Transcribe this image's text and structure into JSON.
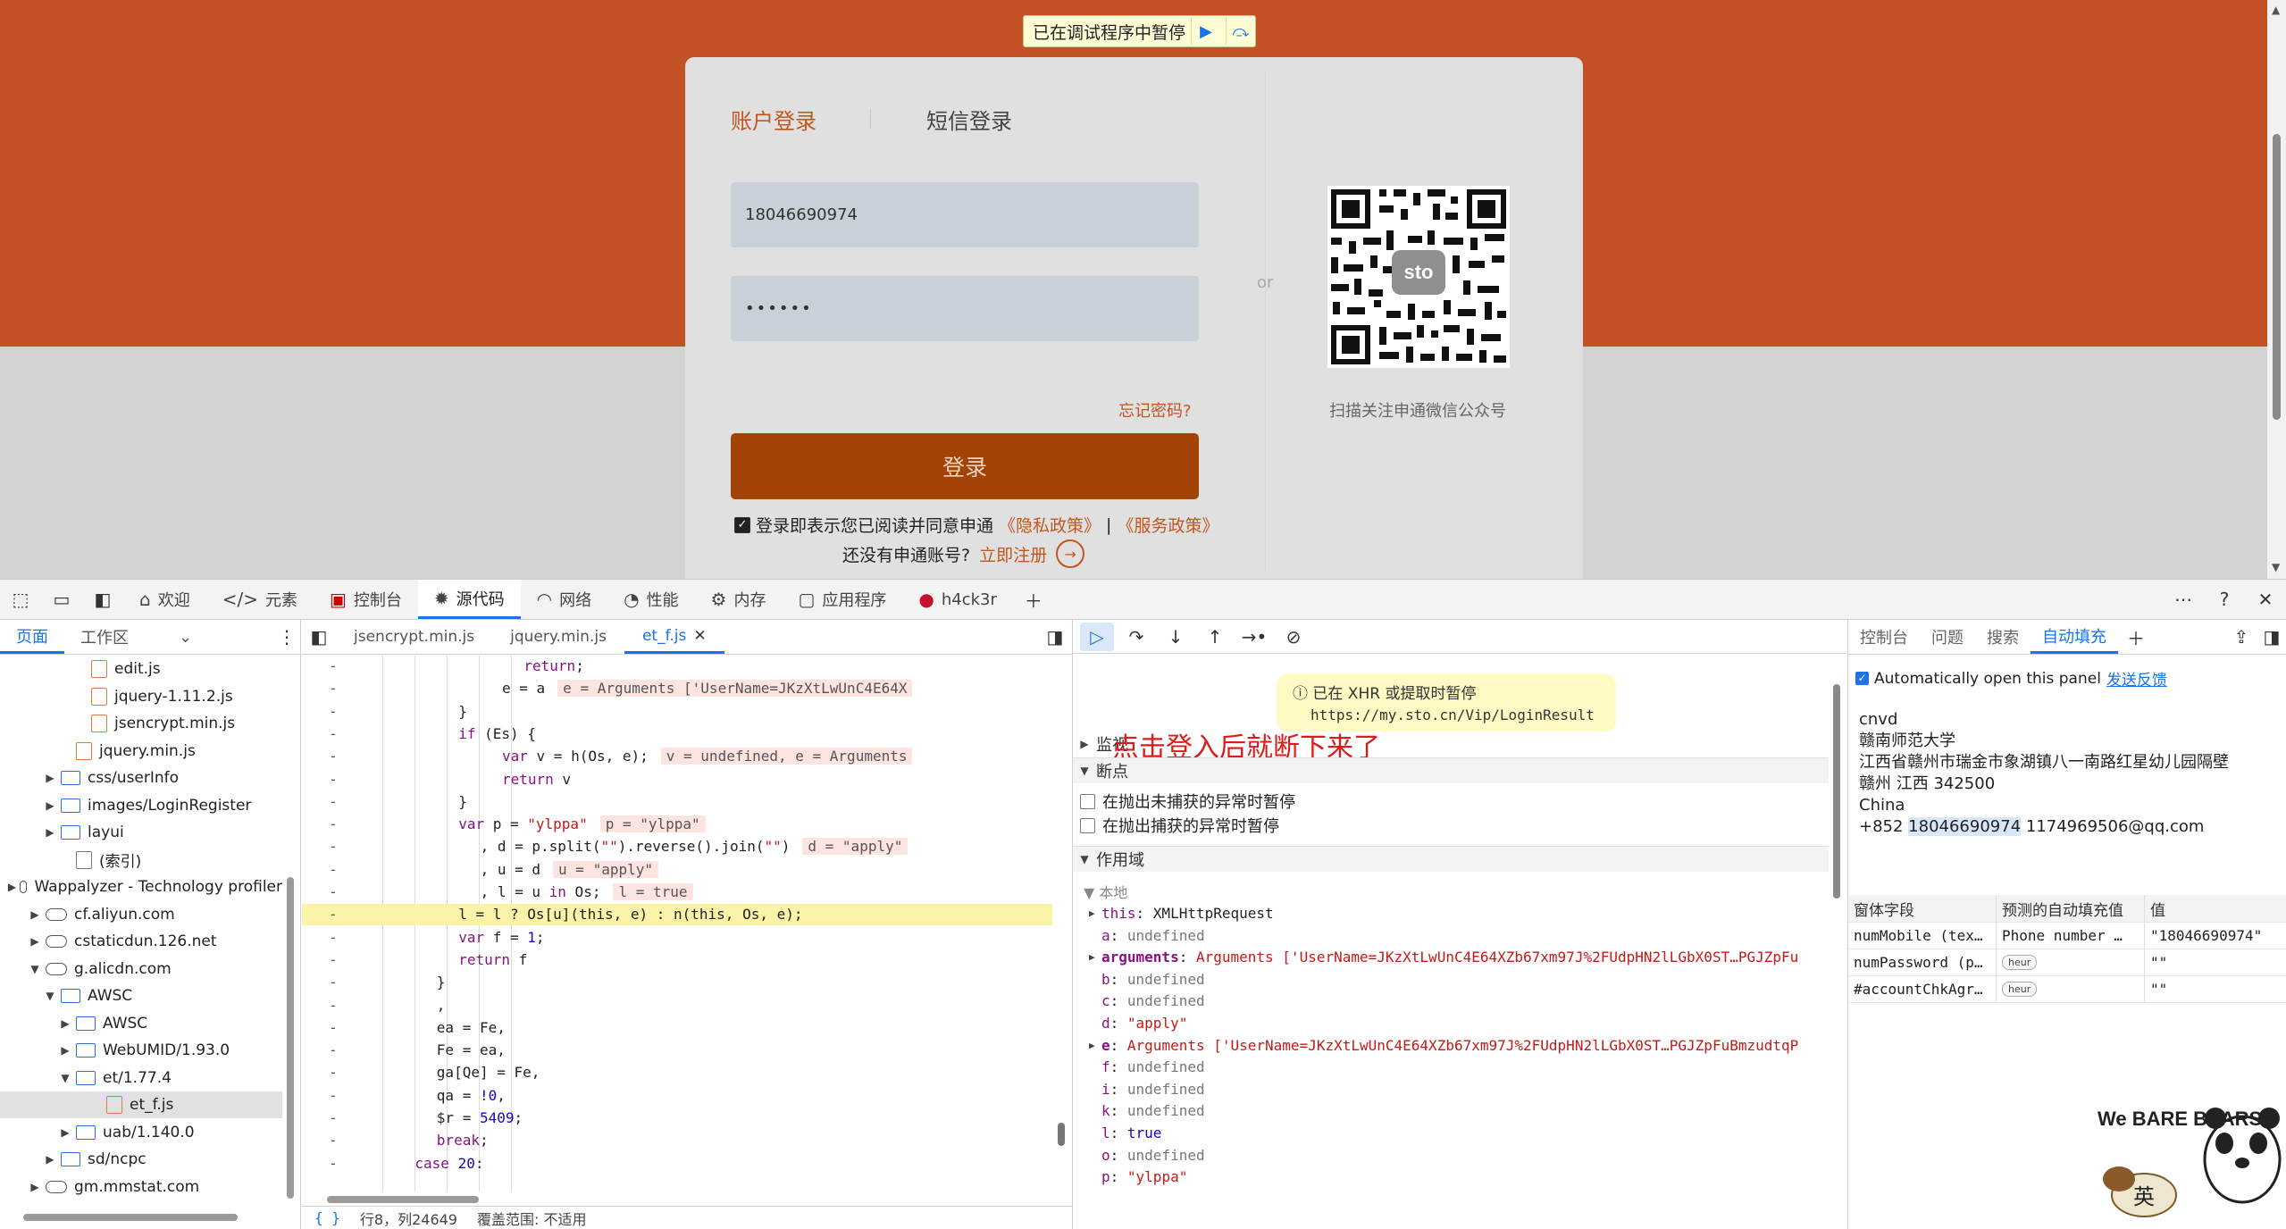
{
  "page": {
    "paused_banner": "已在调试程序中暂停",
    "login": {
      "tabs": [
        "账户登录",
        "短信登录"
      ],
      "phone_value": "18046690974",
      "password_value": "••••••",
      "forgot": "忘记密码?",
      "login_button": "登录",
      "agree_prefix": "登录即表示您已阅读并同意申通",
      "privacy_link": "《隐私政策》",
      "agree_sep": "|",
      "service_link": "《服务政策》",
      "no_account": "还没有申通账号?",
      "register_link": "立即注册",
      "or": "or",
      "qr_caption": "扫描关注申通微信公众号",
      "qr_logo": "sto"
    }
  },
  "devtools": {
    "main_tabs": [
      {
        "label": "欢迎",
        "icon": "home-icon"
      },
      {
        "label": "元素",
        "icon": "code-icon"
      },
      {
        "label": "控制台",
        "icon": "console-icon"
      },
      {
        "label": "源代码",
        "icon": "bug-icon"
      },
      {
        "label": "网络",
        "icon": "wifi-icon"
      },
      {
        "label": "性能",
        "icon": "gauge-icon"
      },
      {
        "label": "内存",
        "icon": "memory-icon"
      },
      {
        "label": "应用程序",
        "icon": "app-icon"
      },
      {
        "label": "h4ck3r",
        "icon": "extension-icon"
      }
    ],
    "navigator": {
      "tabs": [
        "页面",
        "工作区"
      ],
      "tree": [
        {
          "label": "edit.js",
          "type": "file",
          "indent": 4
        },
        {
          "label": "jquery-1.11.2.js",
          "type": "file",
          "indent": 4
        },
        {
          "label": "jsencrypt.min.js",
          "type": "file",
          "indent": 4
        },
        {
          "label": "jquery.min.js",
          "type": "file",
          "indent": 3
        },
        {
          "label": "css/userInfo",
          "type": "folder",
          "indent": 2,
          "arrow": "right"
        },
        {
          "label": "images/LoginRegister",
          "type": "folder",
          "indent": 2,
          "arrow": "right"
        },
        {
          "label": "layui",
          "type": "folder",
          "indent": 2,
          "arrow": "right"
        },
        {
          "label": "(索引)",
          "type": "page",
          "indent": 3
        },
        {
          "label": "Wappalyzer - Technology profiler",
          "type": "cloud",
          "indent": 1,
          "arrow": "right"
        },
        {
          "label": "cf.aliyun.com",
          "type": "cloud",
          "indent": 1,
          "arrow": "right"
        },
        {
          "label": "cstaticdun.126.net",
          "type": "cloud",
          "indent": 1,
          "arrow": "right"
        },
        {
          "label": "g.alicdn.com",
          "type": "cloud",
          "indent": 1,
          "arrow": "down"
        },
        {
          "label": "AWSC",
          "type": "folder",
          "indent": 2,
          "arrow": "down"
        },
        {
          "label": "AWSC",
          "type": "folder",
          "indent": 3,
          "arrow": "right"
        },
        {
          "label": "WebUMID/1.93.0",
          "type": "folder",
          "indent": 3,
          "arrow": "right"
        },
        {
          "label": "et/1.77.4",
          "type": "folder",
          "indent": 3,
          "arrow": "down"
        },
        {
          "label": "et_f.js",
          "type": "file",
          "indent": 5,
          "selected": true
        },
        {
          "label": "uab/1.140.0",
          "type": "folder",
          "indent": 3,
          "arrow": "right"
        },
        {
          "label": "sd/ncpc",
          "type": "folder",
          "indent": 2,
          "arrow": "right"
        },
        {
          "label": "gm.mmstat.com",
          "type": "cloud",
          "indent": 1,
          "arrow": "right"
        }
      ]
    },
    "editor": {
      "tabs": [
        "jsencrypt.min.js",
        "jquery.min.js",
        "et_f.js"
      ],
      "active_tab": "et_f.js",
      "gutter": "-",
      "lines": [
        {
          "indent": 11,
          "parts": [
            [
              "kw",
              "return"
            ],
            [
              "pl",
              ";"
            ]
          ]
        },
        {
          "indent": 10,
          "parts": [
            [
              "pl",
              "e = a"
            ]
          ],
          "ann": "e = Arguments ['UserName=JKzXtLwUnC4E64X"
        },
        {
          "indent": 8,
          "parts": [
            [
              "pl",
              "}"
            ]
          ]
        },
        {
          "indent": 8,
          "parts": [
            [
              "kw",
              "if"
            ],
            [
              "pl",
              " (Es) {"
            ]
          ]
        },
        {
          "indent": 10,
          "parts": [
            [
              "kw",
              "var"
            ],
            [
              "pl",
              " v = h(Os, e);"
            ]
          ],
          "ann": "v = undefined, e = Arguments"
        },
        {
          "indent": 10,
          "parts": [
            [
              "kw",
              "return"
            ],
            [
              "pl",
              " v"
            ]
          ]
        },
        {
          "indent": 8,
          "parts": [
            [
              "pl",
              "}"
            ]
          ]
        },
        {
          "indent": 8,
          "parts": [
            [
              "kw",
              "var"
            ],
            [
              "pl",
              " p = "
            ],
            [
              "str",
              "\"ylppa\""
            ]
          ],
          "ann": "p = \"ylppa\""
        },
        {
          "indent": 9,
          "parts": [
            [
              "pl",
              ", d = p.split("
            ],
            [
              "str",
              "\"\""
            ],
            [
              "pl",
              ").reverse().join("
            ],
            [
              "str",
              "\"\""
            ],
            [
              "pl",
              ")"
            ]
          ],
          "ann": "d = \"apply\""
        },
        {
          "indent": 9,
          "parts": [
            [
              "pl",
              ", u = d"
            ]
          ],
          "ann": "u = \"apply\""
        },
        {
          "indent": 9,
          "parts": [
            [
              "pl",
              ", l = u "
            ],
            [
              "kw",
              "in"
            ],
            [
              "pl",
              " Os;"
            ]
          ],
          "ann": "l = true"
        },
        {
          "indent": 8,
          "parts": [
            [
              "pl",
              "l = l ? Os[u](this, e) : n(this, Os, e);"
            ]
          ],
          "highlight": true
        },
        {
          "indent": 8,
          "parts": [
            [
              "kw",
              "var"
            ],
            [
              "pl",
              " f = "
            ],
            [
              "num",
              "1"
            ],
            [
              "pl",
              ";"
            ]
          ]
        },
        {
          "indent": 8,
          "parts": [
            [
              "kw",
              "return"
            ],
            [
              "pl",
              " f"
            ]
          ]
        },
        {
          "indent": 7,
          "parts": [
            [
              "pl",
              "}"
            ]
          ]
        },
        {
          "indent": 7,
          "parts": [
            [
              "pl",
              ","
            ]
          ]
        },
        {
          "indent": 7,
          "parts": [
            [
              "pl",
              "ea = Fe,"
            ]
          ]
        },
        {
          "indent": 7,
          "parts": [
            [
              "pl",
              "Fe = ea,"
            ]
          ]
        },
        {
          "indent": 7,
          "parts": [
            [
              "pl",
              "ga[Qe] = Fe,"
            ]
          ]
        },
        {
          "indent": 7,
          "parts": [
            [
              "pl",
              "qa = "
            ],
            [
              "num",
              "!0"
            ],
            [
              "pl",
              ","
            ]
          ]
        },
        {
          "indent": 7,
          "parts": [
            [
              "pl",
              "$r = "
            ],
            [
              "num",
              "5409"
            ],
            [
              "pl",
              ";"
            ]
          ]
        },
        {
          "indent": 7,
          "parts": [
            [
              "kw",
              "break"
            ],
            [
              "pl",
              ";"
            ]
          ]
        },
        {
          "indent": 6,
          "parts": [
            [
              "kw",
              "case"
            ],
            [
              "pl",
              " "
            ],
            [
              "num",
              "20"
            ],
            [
              "pl",
              ":"
            ]
          ]
        }
      ],
      "status_braces": "{ }",
      "status_pos": "行8，列24649",
      "status_coverage": "覆盖范围: 不适用"
    },
    "debugger": {
      "xhr_paused_title": "已在 XHR 或提取时暂停",
      "xhr_paused_url": "https://my.sto.cn/Vip/LoginResult",
      "annotation": "点击登入后就断下来了",
      "sections": {
        "watch": "监视",
        "breakpoints": "断点",
        "scope": "作用域",
        "local": "本地"
      },
      "checkbox_uncaught": "在抛出未捕获的异常时暂停",
      "checkbox_caught": "在抛出捕获的异常时暂停",
      "scope_items": [
        {
          "key": "this",
          "value": "XMLHttpRequest",
          "vtype": "v",
          "expand": true,
          "bold": false
        },
        {
          "key": "a",
          "value": "undefined",
          "vtype": "vu"
        },
        {
          "key": "arguments",
          "value": "Arguments ['UserName=JKzXtLwUnC4E64XZb67xm97J%2FUdpHN2lLGbX0ST…PGJZpFu",
          "vtype": "vs",
          "expand": true,
          "bold": true
        },
        {
          "key": "b",
          "value": "undefined",
          "vtype": "vu"
        },
        {
          "key": "c",
          "value": "undefined",
          "vtype": "vu"
        },
        {
          "key": "d",
          "value": "\"apply\"",
          "vtype": "vs"
        },
        {
          "key": "e",
          "value": "Arguments ['UserName=JKzXtLwUnC4E64XZb67xm97J%2FUdpHN2lLGbX0ST…PGJZpFuBmzudtqP",
          "vtype": "vs",
          "expand": true,
          "bold": true
        },
        {
          "key": "f",
          "value": "undefined",
          "vtype": "vu"
        },
        {
          "key": "i",
          "value": "undefined",
          "vtype": "vu"
        },
        {
          "key": "k",
          "value": "undefined",
          "vtype": "vu"
        },
        {
          "key": "l",
          "value": "true",
          "vtype": "vn"
        },
        {
          "key": "o",
          "value": "undefined",
          "vtype": "vu"
        },
        {
          "key": "p",
          "value": "\"ylppa\"",
          "vtype": "vs"
        }
      ]
    },
    "right_panel": {
      "tabs": [
        "控制台",
        "问题",
        "搜索",
        "自动填充"
      ],
      "active_tab": "自动填充",
      "auto_open_label": "Automatically open this panel",
      "feedback_link": "发送反馈",
      "address_lines": [
        "cnvd",
        "赣南师范大学",
        "江西省赣州市瑞金市象湖镇八一南路红星幼儿园隔壁",
        "赣州 江西 342500",
        "China"
      ],
      "phone_prefix": "+852 ",
      "phone_hl": "18046690974",
      "email": " 1174969506@qq.com",
      "table_headers": [
        "窗体字段",
        "预测的自动填充值",
        "值"
      ],
      "table_rows": [
        [
          "numMobile (tex…",
          "Phone number …",
          "\"18046690974\""
        ],
        [
          "numPassword (p…",
          "heur",
          "\"\""
        ],
        [
          "#accountChkAgr…",
          "heur",
          "\"\""
        ]
      ]
    },
    "watermark": {
      "brand": "We BARE BEARS",
      "char": "英"
    }
  }
}
